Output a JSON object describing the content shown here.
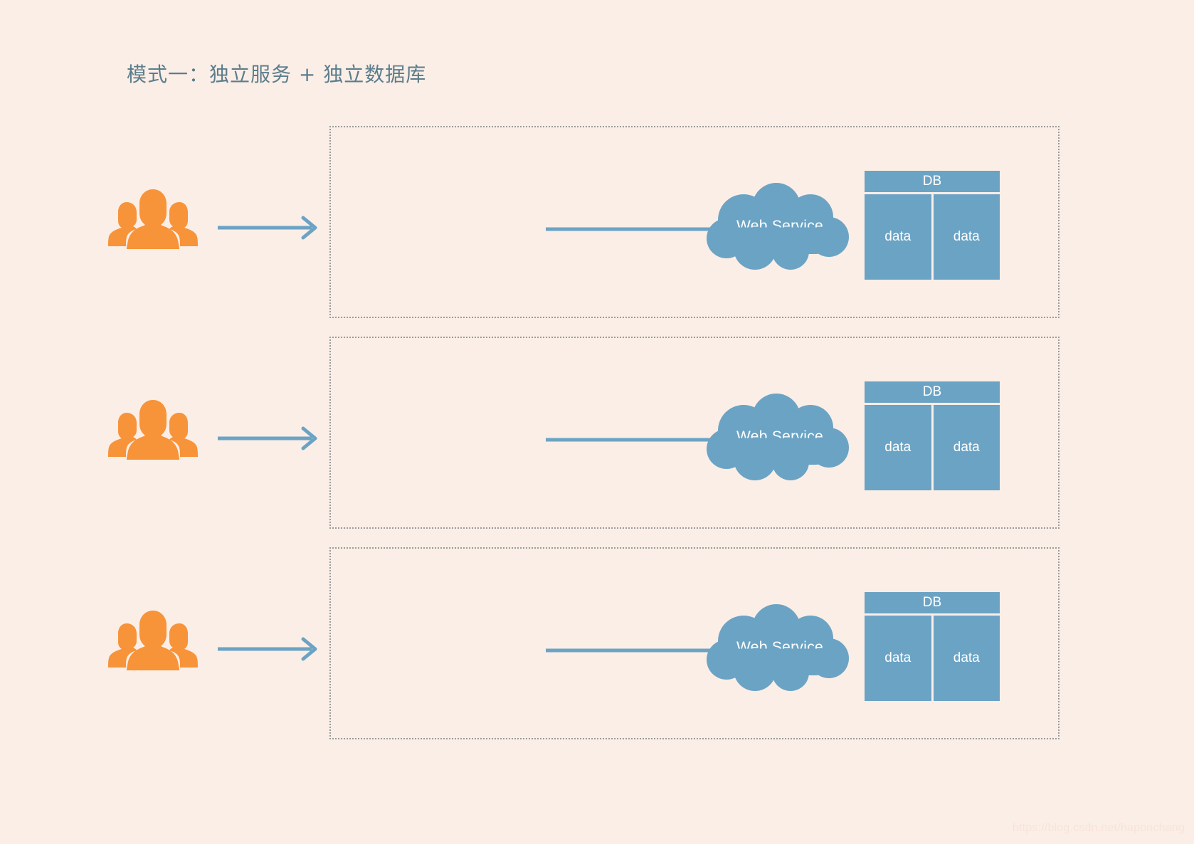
{
  "page": {
    "background_color": "#fbeee6",
    "title": "模式一：独立服务 + 独立数据库",
    "watermark": "https://blog.csdn.net/haponchang"
  },
  "colors": {
    "background": "#fbeee6",
    "title_text": "#5b7d8c",
    "accent_blue": "#6ba3c4",
    "accent_orange": "#f79339",
    "dotted_border": "#9b9b9b",
    "white_text": "#ffffff",
    "watermark_text": "#f7e3d8"
  },
  "rows": [
    {
      "users_icon": "users-group-icon",
      "arrow_user_to_service": "right-arrow-icon",
      "service": {
        "icon": "cloud-icon",
        "label": "Web Service"
      },
      "arrow_service_to_db": "right-arrow-icon",
      "database": {
        "header": "DB",
        "cells": [
          "data",
          "data"
        ]
      }
    },
    {
      "users_icon": "users-group-icon",
      "arrow_user_to_service": "right-arrow-icon",
      "service": {
        "icon": "cloud-icon",
        "label": "Web Service"
      },
      "arrow_service_to_db": "right-arrow-icon",
      "database": {
        "header": "DB",
        "cells": [
          "data",
          "data"
        ]
      }
    },
    {
      "users_icon": "users-group-icon",
      "arrow_user_to_service": "right-arrow-icon",
      "service": {
        "icon": "cloud-icon",
        "label": "Web Service"
      },
      "arrow_service_to_db": "right-arrow-icon",
      "database": {
        "header": "DB",
        "cells": [
          "data",
          "data"
        ]
      }
    }
  ]
}
